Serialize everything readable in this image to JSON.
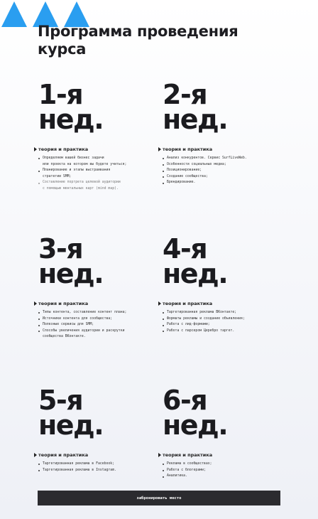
{
  "header": {
    "title": "Программа проведения курса",
    "accent_color": "#2a9ef0"
  },
  "weeks": [
    {
      "title": "1-я",
      "sub": "нед.",
      "section": "теория и практика",
      "items": [
        "Определяем вашей бизнес задачи\nили проекта на котором вы будете учиться;",
        "Планирование и этапы выстраивания\nстратегии SMM;",
        "Составление портрета целевой аудитории\nс помощью ментальных карт (mind map)."
      ]
    },
    {
      "title": "2-я",
      "sub": "нед.",
      "section": "теория и практика",
      "items": [
        "Анализ конкурентов. Сервис SurfLiveWeb.",
        "Особенности социальных медиа;",
        "Позиционирование;",
        "Создание сообщества;",
        "Брендирование."
      ]
    },
    {
      "title": "3-я",
      "sub": "нед.",
      "section": "теория и практика",
      "items": [
        "Типы контента, составление контент плана;",
        "Источники контента для сообщества;",
        "Полезные сервисы для SMM;",
        "Способы увеличения аудитории и раскрутки\nсообщества ВКонтакте."
      ]
    },
    {
      "title": "4-я",
      "sub": "нед.",
      "section": "теория и практика",
      "items": [
        "Таргетированная реклама ВКонтакте;",
        "Форматы рекламы и создание объявления;",
        "Работа с лид-формами;",
        "Работа с парсером Церебро таргет."
      ]
    },
    {
      "title": "5-я",
      "sub": "нед.",
      "section": "теория и практика",
      "items": [
        "Таргетированная реклама в Facebook;",
        "Таргетированная реклама в Instagram."
      ]
    },
    {
      "title": "6-я",
      "sub": "нед.",
      "section": "теория и практика",
      "items": [
        "Реклама в сообществах;",
        "Работа с блогерами;",
        "Аналитика."
      ]
    }
  ],
  "cta": {
    "label": "забронировать место"
  }
}
